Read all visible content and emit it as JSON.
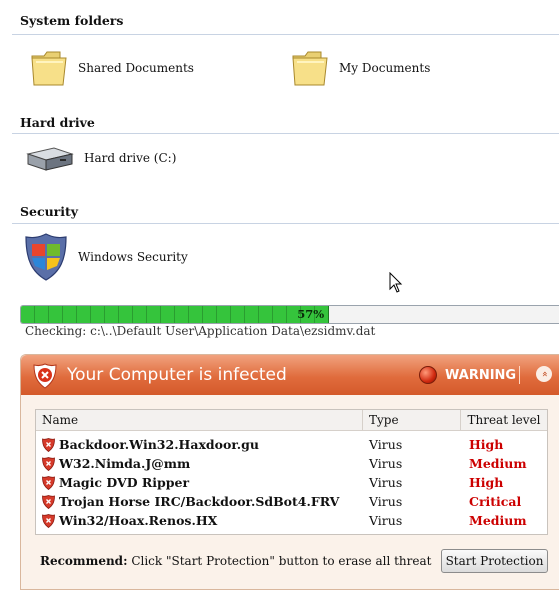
{
  "sections": {
    "system_folders": "System folders",
    "hard_drive": "Hard drive",
    "security": "Security"
  },
  "items": {
    "shared_documents": "Shared Documents",
    "my_documents": "My Documents",
    "hard_drive_c": "Hard drive (C:)",
    "windows_security": "Windows Security"
  },
  "scan": {
    "progress_percent": 57,
    "progress_label": "57%",
    "checking": "Checking: c:\\..\\Default User\\Application Data\\ezsidmv.dat"
  },
  "alert": {
    "title": "Your Computer is infected",
    "warning_label": "WARNING",
    "collapse_glyph": "«",
    "columns": [
      "Name",
      "Type",
      "Threat level"
    ],
    "threats": [
      {
        "name": "Backdoor.Win32.Haxdoor.gu",
        "type": "Virus",
        "level": "High"
      },
      {
        "name": "W32.Nimda.J@mm",
        "type": "Virus",
        "level": "Medium"
      },
      {
        "name": "Magic DVD Ripper",
        "type": "Virus",
        "level": "High"
      },
      {
        "name": "Trojan Horse IRC/Backdoor.SdBot4.FRV",
        "type": "Virus",
        "level": "Critical"
      },
      {
        "name": "Win32/Hoax.Renos.HX",
        "type": "Virus",
        "level": "Medium"
      }
    ],
    "recommend_bold": "Recommend:",
    "recommend_text": " Click \"Start Protection\" button to erase all threat",
    "start_button": "Start Protection"
  },
  "colors": {
    "header_orange": "#e06c3d",
    "threat_red": "#cc0000",
    "progress_green": "#35c43c"
  }
}
